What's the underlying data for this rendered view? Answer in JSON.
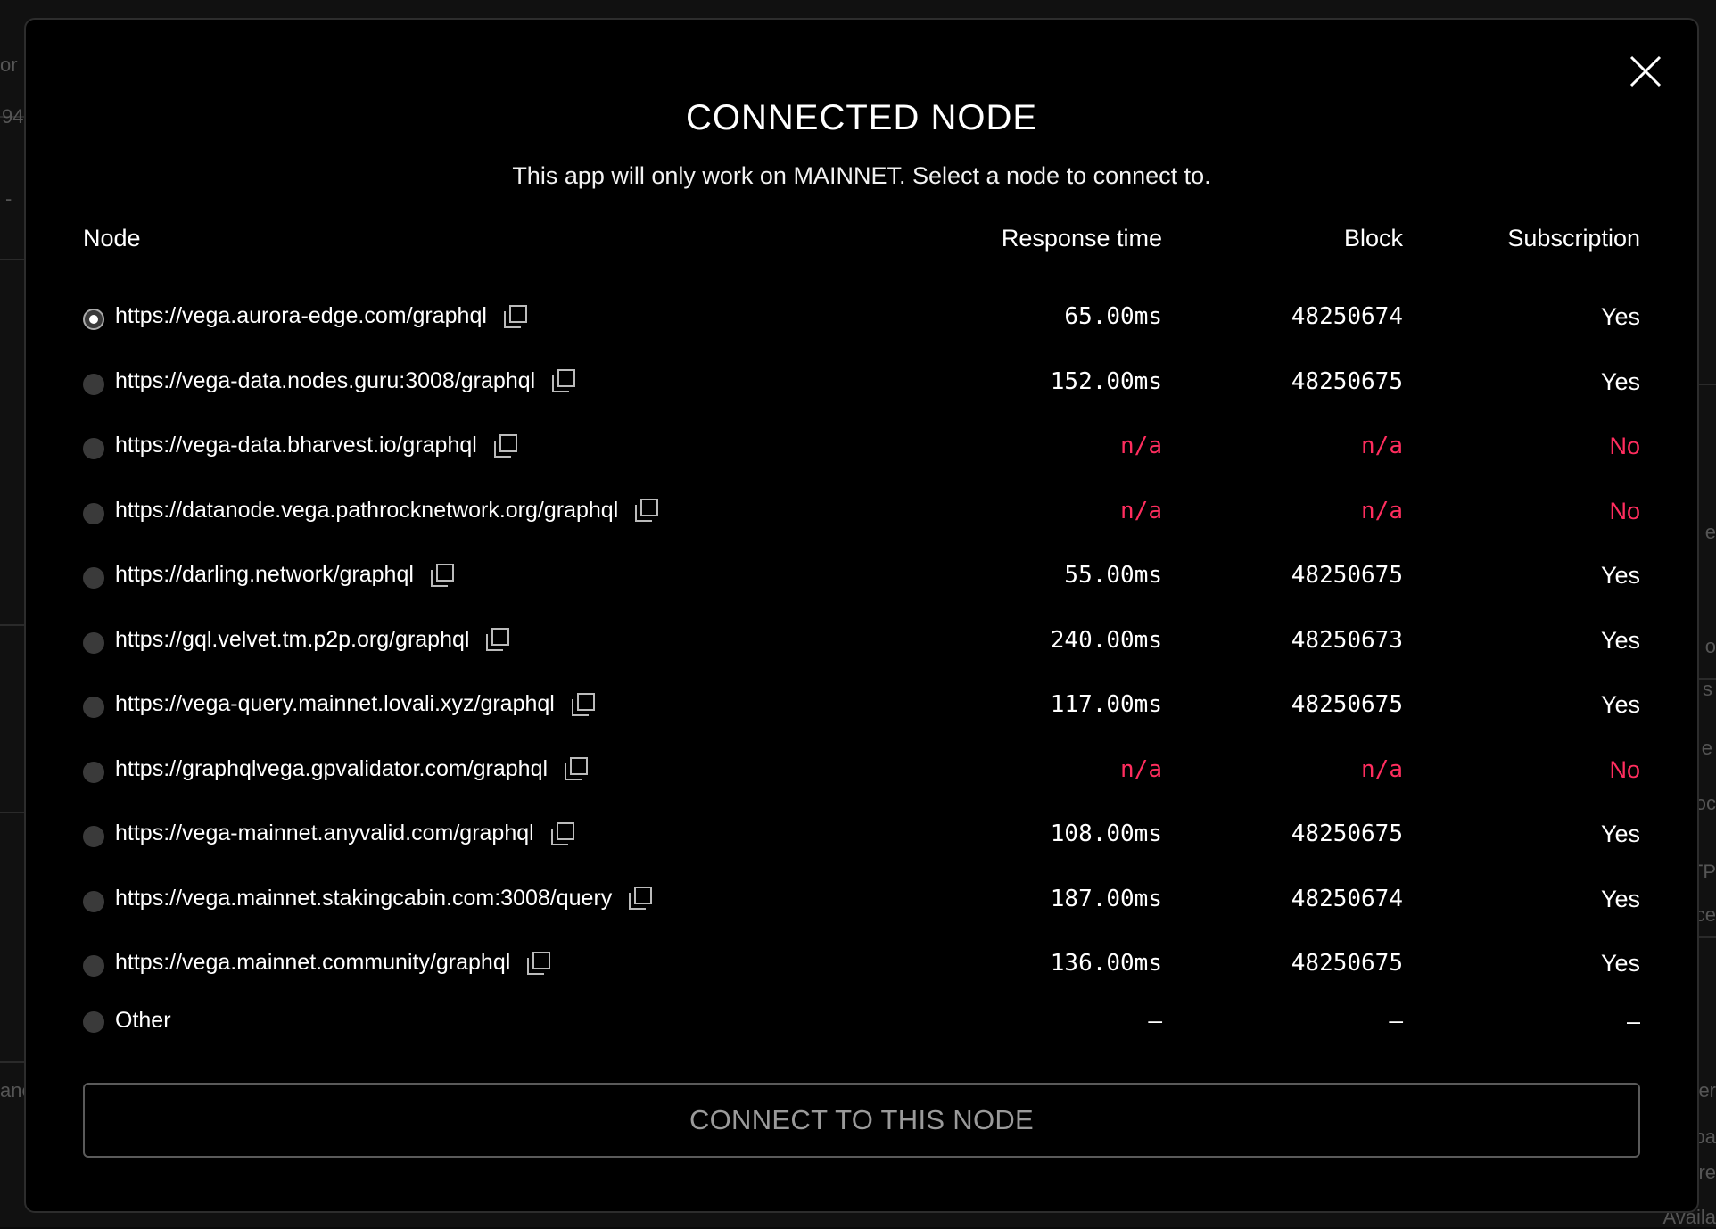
{
  "dialog": {
    "title": "CONNECTED NODE",
    "subtitle": "This app will only work on MAINNET. Select a node to connect to.",
    "columns": {
      "node": "Node",
      "response_time": "Response time",
      "block": "Block",
      "subscription": "Subscription"
    },
    "nodes": [
      {
        "url": "https://vega.aurora-edge.com/graphql",
        "response_time": "65.00ms",
        "block": "48250674",
        "subscription": "Yes",
        "selected": true,
        "status": "ok"
      },
      {
        "url": "https://vega-data.nodes.guru:3008/graphql",
        "response_time": "152.00ms",
        "block": "48250675",
        "subscription": "Yes",
        "selected": false,
        "status": "ok"
      },
      {
        "url": "https://vega-data.bharvest.io/graphql",
        "response_time": "n/a",
        "block": "n/a",
        "subscription": "No",
        "selected": false,
        "status": "error"
      },
      {
        "url": "https://datanode.vega.pathrocknetwork.org/graphql",
        "response_time": "n/a",
        "block": "n/a",
        "subscription": "No",
        "selected": false,
        "status": "error"
      },
      {
        "url": "https://darling.network/graphql",
        "response_time": "55.00ms",
        "block": "48250675",
        "subscription": "Yes",
        "selected": false,
        "status": "ok"
      },
      {
        "url": "https://gql.velvet.tm.p2p.org/graphql",
        "response_time": "240.00ms",
        "block": "48250673",
        "subscription": "Yes",
        "selected": false,
        "status": "ok"
      },
      {
        "url": "https://vega-query.mainnet.lovali.xyz/graphql",
        "response_time": "117.00ms",
        "block": "48250675",
        "subscription": "Yes",
        "selected": false,
        "status": "ok"
      },
      {
        "url": "https://graphqlvega.gpvalidator.com/graphql",
        "response_time": "n/a",
        "block": "n/a",
        "subscription": "No",
        "selected": false,
        "status": "error"
      },
      {
        "url": "https://vega-mainnet.anyvalid.com/graphql",
        "response_time": "108.00ms",
        "block": "48250675",
        "subscription": "Yes",
        "selected": false,
        "status": "ok"
      },
      {
        "url": "https://vega.mainnet.stakingcabin.com:3008/query",
        "response_time": "187.00ms",
        "block": "48250674",
        "subscription": "Yes",
        "selected": false,
        "status": "ok"
      },
      {
        "url": "https://vega.mainnet.community/graphql",
        "response_time": "136.00ms",
        "block": "48250675",
        "subscription": "Yes",
        "selected": false,
        "status": "ok"
      }
    ],
    "other": {
      "label": "Other",
      "response_time": "–",
      "block": "–",
      "subscription": "–"
    },
    "connect_button": "CONNECT TO THIS NODE",
    "icons": {
      "close": "close-icon",
      "copy": "copy-icon"
    },
    "colors": {
      "error": "#ff2d5e",
      "background": "#000000",
      "text": "#ffffff"
    }
  },
  "background": {
    "left_fragments": [
      "or",
      "94",
      "-",
      "anc"
    ],
    "right_fragments": [
      "e",
      "o",
      "s",
      "e",
      "oc",
      "TP",
      "ce",
      "er",
      "pa",
      "re",
      "Availa"
    ]
  }
}
